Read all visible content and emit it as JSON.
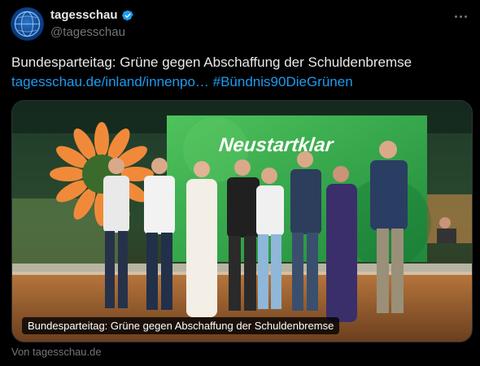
{
  "author": {
    "display_name": "tagesschau",
    "handle": "@tagesschau",
    "verified_icon": "verified-badge-icon",
    "avatar_icon": "tagesschau-globe-logo"
  },
  "menu": {
    "icon": "more-options-icon"
  },
  "tweet": {
    "text": "Bundesparteitag: Grüne gegen Abschaffung der Schuldenbremse",
    "link_text": "tagesschau.de/inland/innenpo…",
    "hashtag": "#Bündnis90DieGrünen"
  },
  "card": {
    "stage_sign": "Neustartklar",
    "caption": "Bundesparteitag: Grüne gegen Abschaffung der Schuldenbremse"
  },
  "source_label": "Von tagesschau.de",
  "colors": {
    "accent_link": "#1d9bf0",
    "background": "#000000",
    "muted_text": "#71767b",
    "stage_green": "#2fa64a",
    "sunflower_orange": "#f08a3a"
  }
}
